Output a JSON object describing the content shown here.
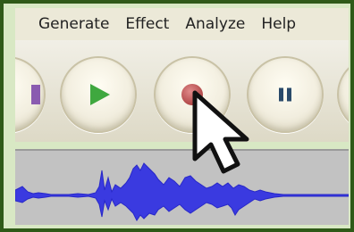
{
  "menubar": {
    "items": [
      {
        "label": "Generate"
      },
      {
        "label": "Effect"
      },
      {
        "label": "Analyze"
      },
      {
        "label": "Help"
      }
    ]
  },
  "toolbar": {
    "buttons": [
      {
        "name": "skip-start",
        "icon": "skip-start-icon"
      },
      {
        "name": "play",
        "icon": "play-icon",
        "color": "#3fa83f"
      },
      {
        "name": "record",
        "icon": "record-icon",
        "color": "#b14848"
      },
      {
        "name": "pause",
        "icon": "pause-icon",
        "color": "#2a4a6a"
      },
      {
        "name": "stop",
        "icon": "stop-icon"
      }
    ]
  },
  "track": {
    "waveform_color": "#3a3ae0",
    "background_color": "#c2c2c2"
  },
  "colors": {
    "frame": "#2f5a18",
    "accent_bg": "#d8e8c4"
  }
}
